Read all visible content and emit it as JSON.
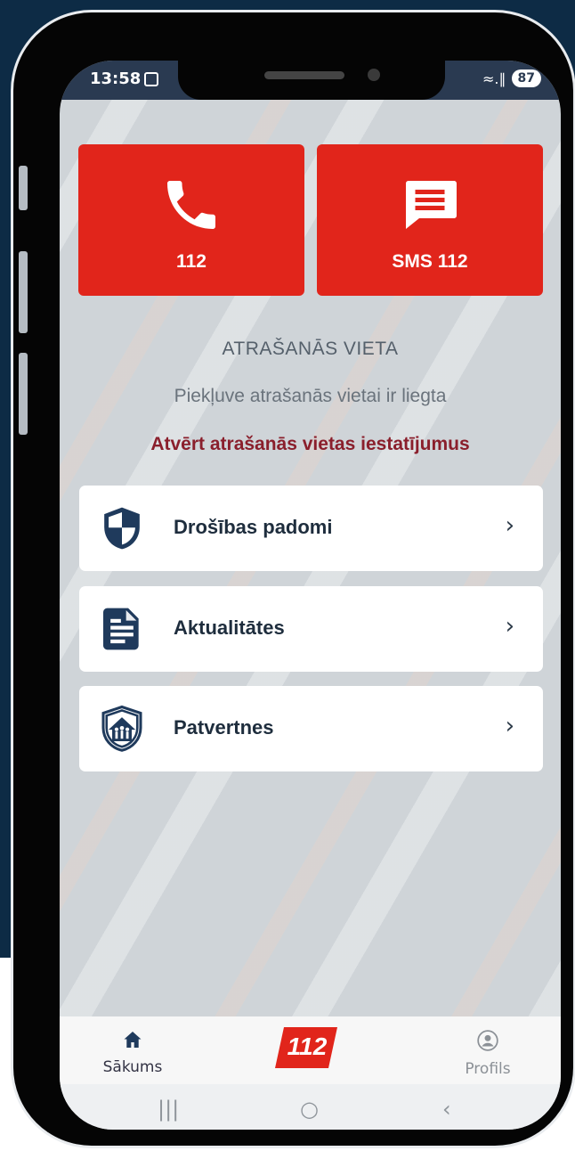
{
  "status_bar": {
    "time": "13:58",
    "signal": "≈.∥",
    "battery": "87"
  },
  "emergency": {
    "call_label": "112",
    "sms_label": "SMS 112",
    "accent_color": "#e1251b"
  },
  "location": {
    "title": "ATRAŠANĀS VIETA",
    "status": "Piekļuve atrašanās vietai ir liegta",
    "settings_link": "Atvērt atrašanās vietas iestatījumus"
  },
  "menu": {
    "items": [
      {
        "label": "Drošības padomi",
        "icon": "shield-icon",
        "chevron": "›"
      },
      {
        "label": "Aktualitātes",
        "icon": "document-icon",
        "chevron": "›"
      },
      {
        "label": "Patvertnes",
        "icon": "shelter-icon",
        "chevron": "›"
      }
    ]
  },
  "tabbar": {
    "home_label": "Sākums",
    "logo_text": "112",
    "profile_label": "Profils"
  },
  "system_nav": {
    "recents": "|||",
    "home": "○",
    "back": "‹"
  }
}
